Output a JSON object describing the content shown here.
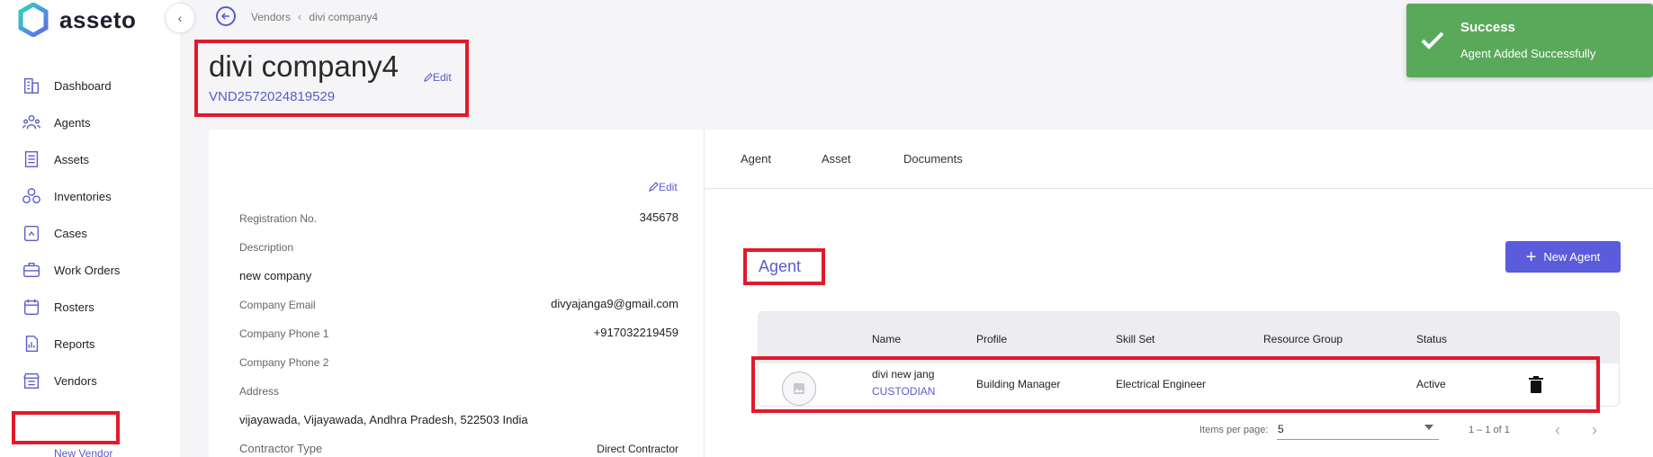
{
  "app": {
    "name": "asseto"
  },
  "sidebar": {
    "items": [
      {
        "label": "Dashboard",
        "icon": "building-icon"
      },
      {
        "label": "Agents",
        "icon": "agents-icon"
      },
      {
        "label": "Assets",
        "icon": "assets-icon"
      },
      {
        "label": "Inventories",
        "icon": "inventories-icon"
      },
      {
        "label": "Cases",
        "icon": "cases-icon"
      },
      {
        "label": "Work Orders",
        "icon": "work-orders-icon"
      },
      {
        "label": "Rosters",
        "icon": "calendar-icon"
      },
      {
        "label": "Reports",
        "icon": "reports-icon"
      },
      {
        "label": "Vendors",
        "icon": "vendors-icon"
      }
    ],
    "sub_item": "New Vendor"
  },
  "breadcrumb": {
    "parent": "Vendors",
    "current": "divi company4"
  },
  "vendor": {
    "name": "divi company4",
    "code": "VND2572024819529",
    "edit_label": "Edit"
  },
  "details": {
    "edit_label": "Edit",
    "registration_label": "Registration No.",
    "registration_value": "345678",
    "description_label": "Description",
    "description_value": "new company",
    "email_label": "Company Email",
    "email_value": "divyajanga9@gmail.com",
    "phone1_label": "Company Phone 1",
    "phone1_value": "+917032219459",
    "phone2_label": "Company Phone 2",
    "address_label": "Address",
    "address_value": "vijayawada, Vijayawada, Andhra Pradesh, 522503 India",
    "contractor_label": "Contractor Type",
    "contractor_value": "Direct Contractor"
  },
  "tabs": [
    "Agent",
    "Asset",
    "Documents"
  ],
  "agent_section": {
    "title": "Agent",
    "new_button": "New Agent",
    "columns": [
      "Name",
      "Profile",
      "Skill Set",
      "Resource Group",
      "Status"
    ],
    "rows": [
      {
        "name": "divi new jang",
        "role": "CUSTODIAN",
        "profile": "Building Manager",
        "skill_set": "Electrical Engineer",
        "resource_group": "",
        "status": "Active"
      }
    ]
  },
  "pagination": {
    "items_per_page_label": "Items per page:",
    "items_per_page": "5",
    "range": "1 – 1 of 1"
  },
  "toast": {
    "title": "Success",
    "message": "Agent Added Successfully"
  },
  "colors": {
    "accent": "#5a5cc9",
    "highlight": "#e01a2b",
    "success": "#5aa95a"
  }
}
